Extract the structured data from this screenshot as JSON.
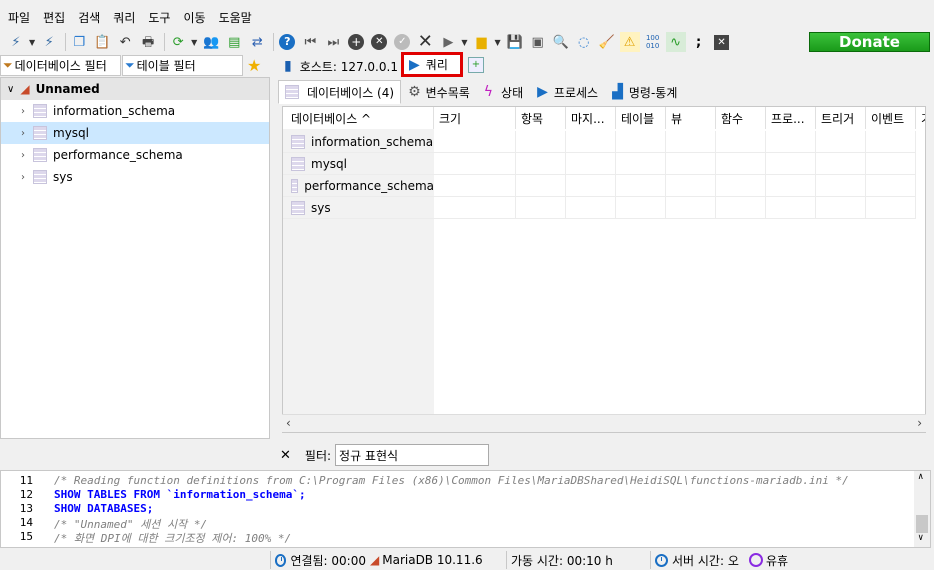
{
  "menu": [
    "파일",
    "편집",
    "검색",
    "쿼리",
    "도구",
    "이동",
    "도움말"
  ],
  "toolbar": {
    "donate_label": "Donate"
  },
  "left": {
    "db_filter_placeholder": "데이터베이스 필터",
    "table_filter_placeholder": "테이블 필터",
    "root": "Unnamed",
    "databases": [
      "information_schema",
      "mysql",
      "performance_schema",
      "sys"
    ],
    "selected": "mysql"
  },
  "tabs": {
    "host": "호스트: 127.0.0.1",
    "query": "쿼리"
  },
  "subtabs": [
    "데이터베이스 (4)",
    "변수목록",
    "상태",
    "프로세스",
    "명령-통계"
  ],
  "grid": {
    "columns": [
      "데이터베이스 ^",
      "크기",
      "항목",
      "마지...",
      "테이블",
      "뷰",
      "함수",
      "프로...",
      "트리거",
      "이벤트",
      "기"
    ],
    "rows": [
      "information_schema",
      "mysql",
      "performance_schema",
      "sys"
    ]
  },
  "filter": {
    "label": "필터:",
    "placeholder": "정규 표현식"
  },
  "sql": {
    "line_numbers": [
      "11",
      "12",
      "13",
      "14",
      "15"
    ],
    "lines": [
      "/* Reading function definitions from C:\\Program Files (x86)\\Common Files\\MariaDBShared\\HeidiSQL\\functions-mariadb.ini */",
      "SHOW TABLES FROM `information_schema`;",
      "SHOW DATABASES;",
      "/* \"Unnamed\" 세션 시작 */",
      "/* 화면 DPI에 대한 크기조정 제어: 100% */"
    ]
  },
  "status": {
    "connected": "연결됨: 00:00",
    "server": "MariaDB 10.11.6",
    "uptime": "가동 시간: 00:10 h",
    "server_time": "서버 시간: 오",
    "idle": "유휴"
  }
}
